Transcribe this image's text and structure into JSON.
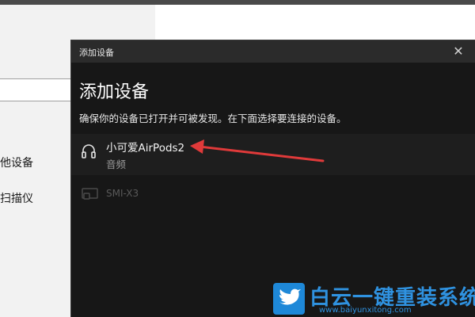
{
  "background": {
    "items": [
      "他设备",
      "扫描仪"
    ]
  },
  "dialog": {
    "titlebar_title": "添加设备",
    "heading": "添加设备",
    "description": "确保你的设备已打开并可被发现。在下面选择要连接的设备。",
    "close_symbol": "✕",
    "devices": [
      {
        "name": "小可爱AirPods2",
        "type": "音频",
        "icon": "headphones-icon"
      },
      {
        "name": "SMI-X3",
        "icon": "display-device-icon"
      }
    ]
  },
  "annotation": {
    "color": "#e03a3a"
  },
  "watermark": {
    "title": "白云一键重装系统",
    "url": "www.baiyunxitong.com",
    "color": "#1e88d8"
  }
}
